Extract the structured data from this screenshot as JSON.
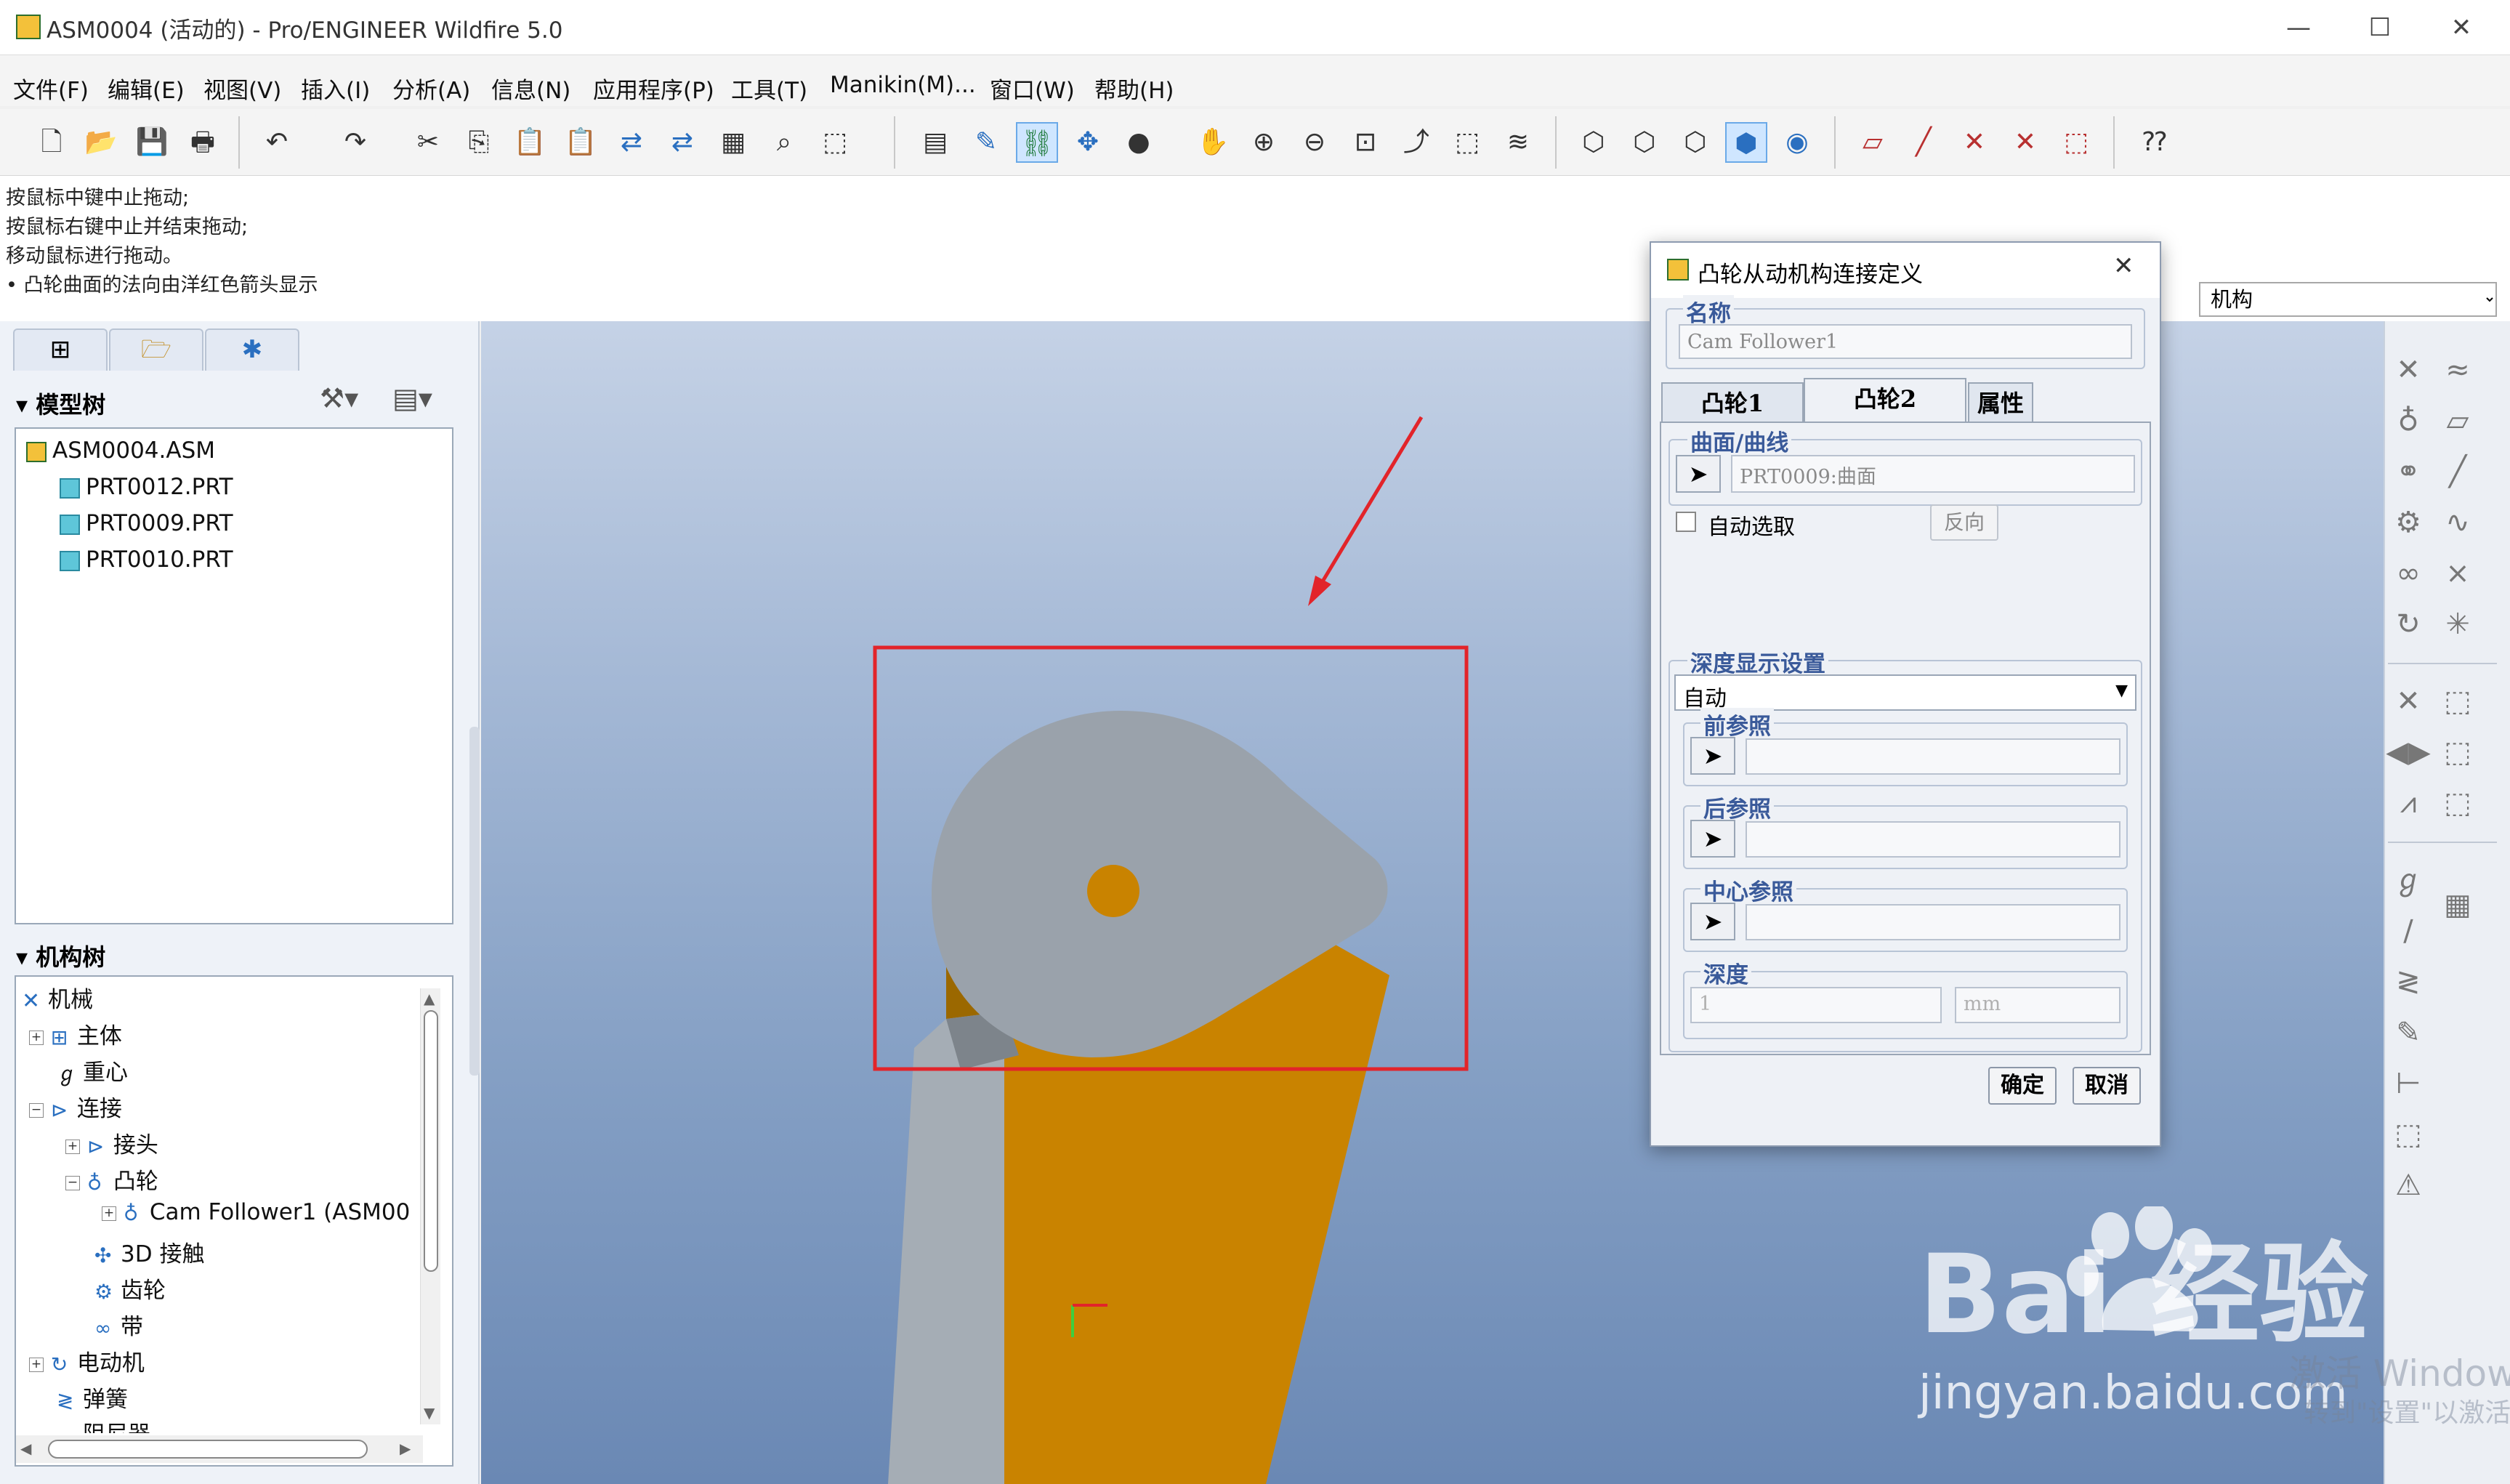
{
  "window": {
    "title": "ASM0004 (活动的) - Pro/ENGINEER Wildfire 5.0",
    "minimize_glyph": "—",
    "maximize_glyph": "☐",
    "close_glyph": "✕"
  },
  "menubar": {
    "items": [
      "文件(F)",
      "编辑(E)",
      "视图(V)",
      "插入(I)",
      "分析(A)",
      "信息(N)",
      "应用程序(P)",
      "工具(T)",
      "Manikin(M)...",
      "窗口(W)",
      "帮助(H)"
    ]
  },
  "messages": [
    "按鼠标中键中止拖动;",
    "按鼠标右键中止并结束拖动;",
    "移动鼠标进行拖动。",
    "• 凸轮曲面的法向由洋红色箭头显示"
  ],
  "right_dropdown": {
    "value": "机构"
  },
  "left_panel": {
    "model_tree": {
      "title": "模型树",
      "items": [
        "ASM0004.ASM",
        "PRT0012.PRT",
        "PRT0009.PRT",
        "PRT0010.PRT"
      ]
    },
    "mechanism_tree": {
      "title": "机构树",
      "items": {
        "root": "机械",
        "bodies": "主体",
        "cg": "重心",
        "connections": "连接",
        "joints": "接头",
        "cams": "凸轮",
        "cam_follower": "Cam Follower1 (ASM00",
        "contact3d": "3D 接触",
        "gears": "齿轮",
        "belts": "带",
        "motors": "电动机",
        "springs": "弹簧",
        "dampers": "阻尼器"
      }
    }
  },
  "dialog": {
    "title": "凸轮从动机构连接定义",
    "name_label": "名称",
    "name_value": "Cam Follower1",
    "tabs": [
      "凸轮1",
      "凸轮2",
      "属性"
    ],
    "active_tab": "凸轮2",
    "surface_label": "曲面/曲线",
    "surface_value": "PRT0009:曲面",
    "auto_select_label": "自动选取",
    "flip_label": "反向",
    "depth_display_label": "深度显示设置",
    "depth_display_value": "自动",
    "front_ref_label": "前参照",
    "back_ref_label": "后参照",
    "center_ref_label": "中心参照",
    "depth_label": "深度",
    "depth_value": "1",
    "depth_unit": "mm",
    "ok_label": "确定",
    "cancel_label": "取消"
  },
  "watermarks": {
    "baidu": "Bai 经验",
    "url": "jingyan.baidu.com",
    "activate": "激活 Windows",
    "activate_sub": "转到\"设置\"以激活"
  },
  "colors": {
    "cam_gray": "#a0a8b0",
    "follower_orange": "#c98300",
    "highlight_red": "#e2242a",
    "tree_link_blue": "#2a6fc0"
  }
}
